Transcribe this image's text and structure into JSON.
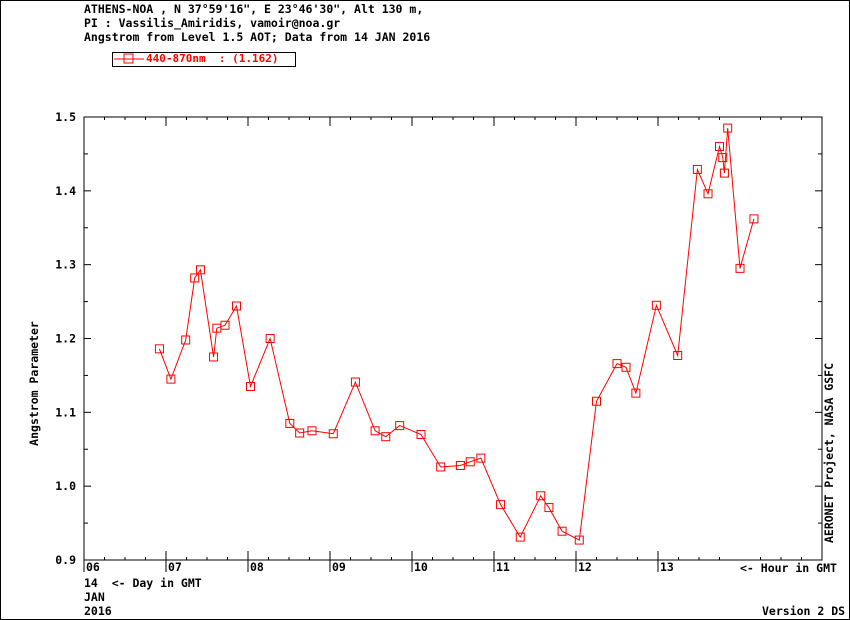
{
  "header": {
    "line1": "ATHENS-NOA , N 37°59'16\", E 23°46'30\", Alt 130 m,",
    "line2": "PI : Vassilis_Amiridis, vamoir@noa.gr",
    "line3": "Angstrom from Level 1.5 AOT; Data from 14 JAN 2016"
  },
  "legend": {
    "label": "440-870nm  : (1.162)"
  },
  "footer": {
    "day_line": "14  <- Day in GMT",
    "hour_label": "<- Hour in GMT",
    "month": "JAN",
    "year": "2016",
    "version": "Version 2 DS"
  },
  "side_label": "AERONET Project, NASA GSFC",
  "chart_data": {
    "type": "line",
    "ylabel": "Angstrom Parameter",
    "xlabel": "",
    "xlim": [
      6,
      15.0
    ],
    "ylim": [
      0.9,
      1.5
    ],
    "x_ticks": [
      "06",
      "07",
      "08",
      "09",
      "10",
      "11",
      "12",
      "13"
    ],
    "y_ticks": [
      "0.9",
      "1.0",
      "1.1",
      "1.2",
      "1.3",
      "1.4",
      "1.5"
    ],
    "color": "#ff0000",
    "series": [
      {
        "name": "440-870nm",
        "x": [
          6.92,
          7.06,
          7.24,
          7.35,
          7.42,
          7.58,
          7.62,
          7.72,
          7.86,
          8.03,
          8.27,
          8.51,
          8.63,
          8.78,
          9.04,
          9.31,
          9.55,
          9.68,
          9.85,
          10.11,
          10.35,
          10.59,
          10.71,
          10.84,
          11.08,
          11.32,
          11.57,
          11.67,
          11.83,
          12.04,
          12.25,
          12.5,
          12.61,
          12.73,
          12.98,
          13.24,
          13.48,
          13.61,
          13.75,
          13.79,
          13.81,
          13.85,
          14.0,
          14.17
        ],
        "y": [
          1.186,
          1.145,
          1.198,
          1.282,
          1.293,
          1.175,
          1.214,
          1.218,
          1.244,
          1.135,
          1.2,
          1.085,
          1.072,
          1.075,
          1.071,
          1.141,
          1.075,
          1.067,
          1.082,
          1.07,
          1.026,
          1.028,
          1.033,
          1.038,
          0.975,
          0.931,
          0.987,
          0.971,
          0.939,
          0.927,
          1.115,
          1.166,
          1.161,
          1.126,
          1.245,
          1.177,
          1.429,
          1.396,
          1.46,
          1.445,
          1.424,
          1.485,
          1.295,
          1.362
        ]
      }
    ]
  }
}
